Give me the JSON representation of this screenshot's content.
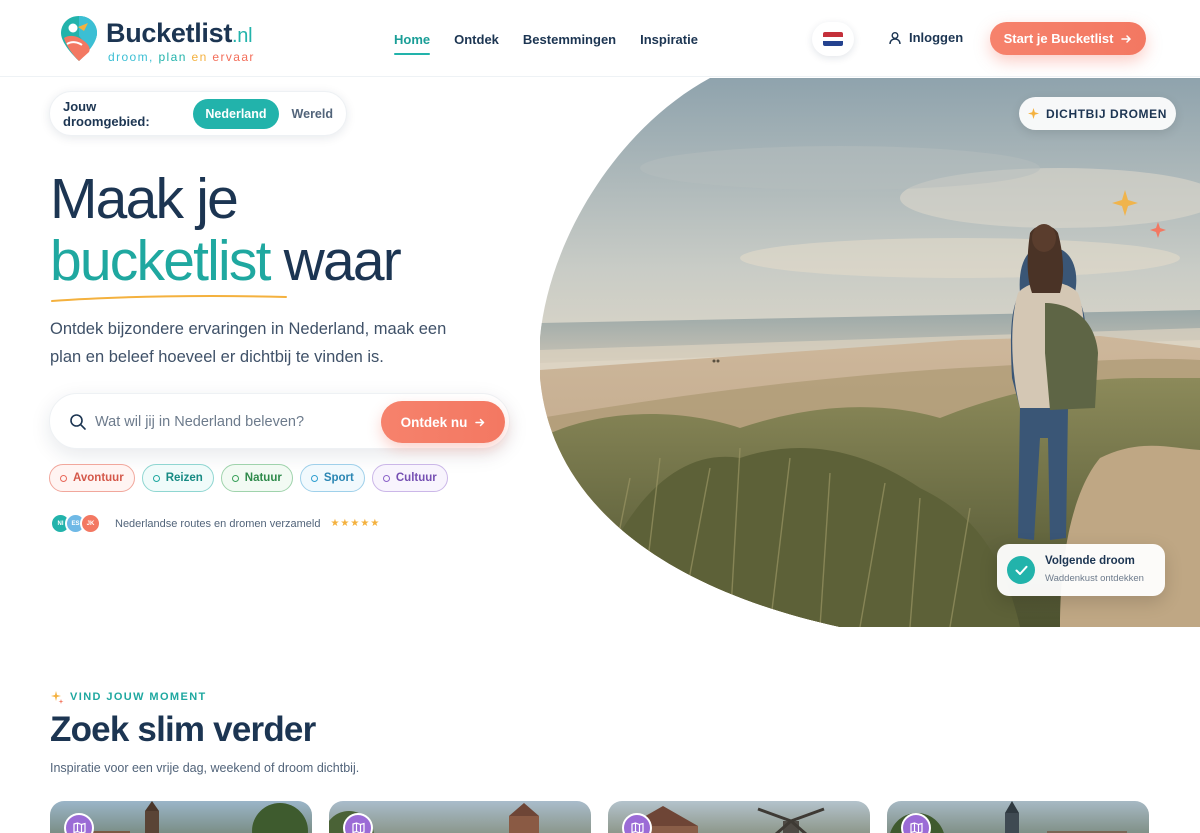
{
  "header": {
    "logo": {
      "name": "Bucketlist",
      "tld": ".nl",
      "tagline": {
        "w1": "droom,",
        "w2": "plan",
        "w3": "en",
        "w4": "ervaar"
      }
    },
    "nav": [
      "Home",
      "Ontdek",
      "Bestemmingen",
      "Inspiratie"
    ],
    "active_nav": "Home",
    "language_flag": "flag-nl-icon",
    "login_label": "Inloggen",
    "cta_label": "Start je Bucketlist"
  },
  "hero": {
    "region_label": "Jouw droomgebied:",
    "region_options": [
      "Nederland",
      "Wereld"
    ],
    "region_selected": "Nederland",
    "title_line1": "Maak je",
    "title_accent": "bucketlist",
    "title_rest": " waar",
    "lead": "Ontdek bijzondere ervaringen in Nederland, maak een plan en beleef hoeveel er dichtbij te vinden is.",
    "search": {
      "placeholder": "Wat wil jij in Nederland beleven?",
      "value": "",
      "button": "Ontdek nu"
    },
    "tags": [
      "Avontuur",
      "Reizen",
      "Natuur",
      "Sport",
      "Cultuur"
    ],
    "avatars": [
      "NI",
      "ES",
      "JK"
    ],
    "proof_text": "Nederlandse routes en dromen verzameld",
    "rating_stars": "★★★★★",
    "image_badge": "DICHTBIJ DROMEN",
    "next_card": {
      "title": "Volgende droom",
      "subtitle": "Waddenkust ontdekken"
    }
  },
  "section": {
    "eyebrow": "VIND JOUW MOMENT",
    "title": "Zoek slim verder",
    "subtitle": "Inspiratie voor een vrije dag, weekend of droom dichtbij."
  },
  "colors": {
    "brand_teal": "#22b3ab",
    "brand_coral": "#f37862",
    "navy": "#1c3552",
    "tag_avontuur": "#e8685a",
    "tag_reizen": "#1fa8a0",
    "tag_natuur": "#3aa05b",
    "tag_sport": "#2f9fd0",
    "tag_cultuur": "#8b63c9"
  }
}
